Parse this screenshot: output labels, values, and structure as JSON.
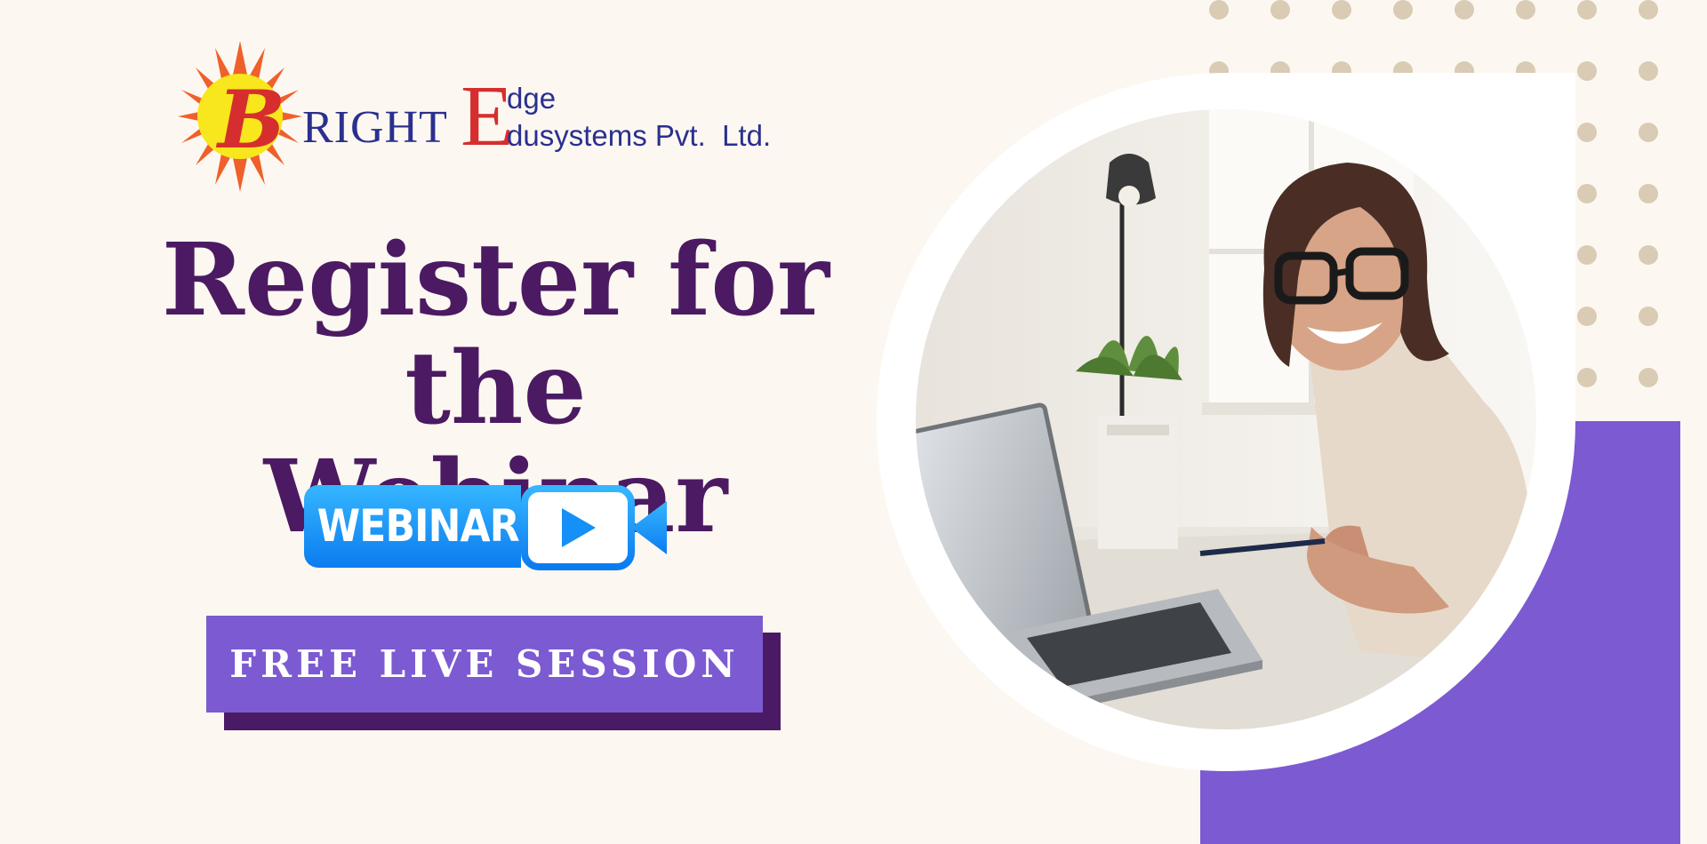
{
  "brand": {
    "logo_letter": "B",
    "logo_rest": "RIGHT",
    "logo_E": "E",
    "logo_dge": "dge",
    "logo_dusystems": "dusystems Pvt.  Ltd."
  },
  "headline": {
    "line1": "Register for the",
    "line2": "Webinar"
  },
  "badge": {
    "label": "WEBINAR",
    "icon": "video-camera-play-icon"
  },
  "cta": {
    "label": "FREE LIVE SESSION"
  },
  "colors": {
    "background": "#fcf8f1",
    "headline": "#4b1a62",
    "accent_purple": "#7c5ad2",
    "shadow_purple": "#4a1a65",
    "badge_blue": "#1590f7",
    "dots": "#d9cbb4",
    "logo_blue": "#2b2f8f",
    "logo_red": "#d62e2e"
  }
}
